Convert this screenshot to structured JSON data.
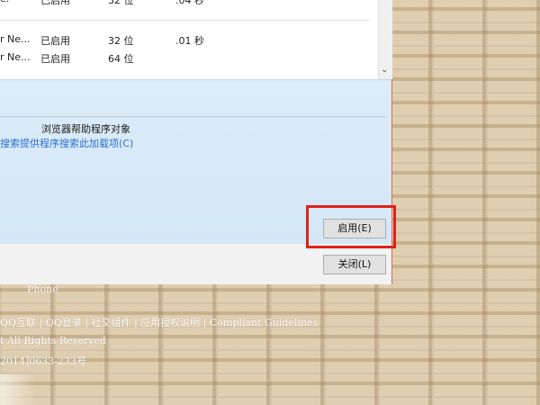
{
  "list": {
    "rows": [
      {
        "name": "e.",
        "status": "已启用",
        "arch": "32 位",
        "time": ".04 秒"
      },
      {
        "name": "r Ne...",
        "status": "已启用",
        "arch": "32 位",
        "time": ".01 秒"
      },
      {
        "name": "r Ne...",
        "status": "已启用",
        "arch": "64 位",
        "time": ""
      }
    ]
  },
  "info": {
    "type_text": "浏览器帮助程序对象",
    "search_link": "搜索提供程序搜索此加载项(C)"
  },
  "buttons": {
    "enable": "启用(E)",
    "close": "关闭(L)"
  },
  "footer": {
    "phone": "Phone",
    "links": "QQ互联 | QQ登录 | 社交组件 | 应用授权说明 | Compliant Guidelines",
    "rights": "t All Rights Reserved",
    "icp": "2014]0633-233号"
  },
  "colors": {
    "highlight": "#e0201a",
    "link": "#2a6fd0"
  }
}
